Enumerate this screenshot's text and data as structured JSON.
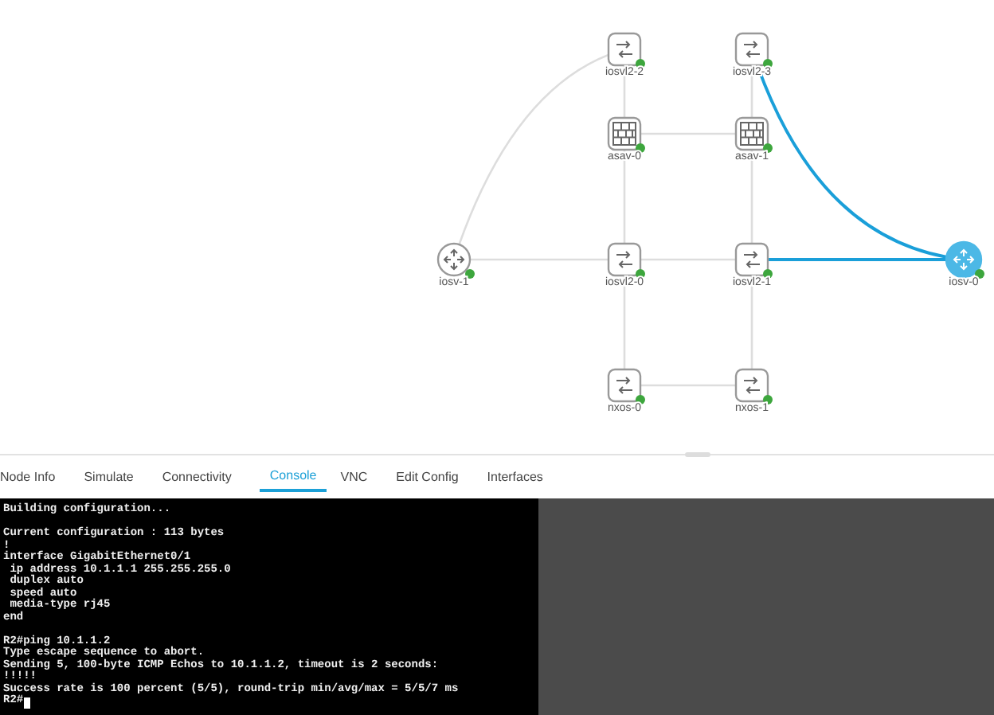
{
  "topology": {
    "nodes": [
      {
        "label": "iosvl2-2",
        "kind": "switch",
        "running": true,
        "selected": false
      },
      {
        "label": "iosvl2-3",
        "kind": "switch",
        "running": true,
        "selected": false
      },
      {
        "label": "asav-0",
        "kind": "firewall",
        "running": true,
        "selected": false
      },
      {
        "label": "asav-1",
        "kind": "firewall",
        "running": true,
        "selected": false
      },
      {
        "label": "iosv-1",
        "kind": "router",
        "running": true,
        "selected": false
      },
      {
        "label": "iosvl2-0",
        "kind": "switch",
        "running": true,
        "selected": false
      },
      {
        "label": "iosvl2-1",
        "kind": "switch",
        "running": true,
        "selected": false
      },
      {
        "label": "iosv-0",
        "kind": "router",
        "running": true,
        "selected": true
      },
      {
        "label": "nxos-0",
        "kind": "switch",
        "running": true,
        "selected": false
      },
      {
        "label": "nxos-1",
        "kind": "switch",
        "running": true,
        "selected": false
      }
    ]
  },
  "tabs": [
    {
      "label": "Node Info",
      "selected": false
    },
    {
      "label": "Simulate",
      "selected": false
    },
    {
      "label": "Connectivity",
      "selected": false
    },
    {
      "label": "Console",
      "selected": true
    },
    {
      "label": "VNC",
      "selected": false
    },
    {
      "label": "Edit Config",
      "selected": false
    },
    {
      "label": "Interfaces",
      "selected": false
    }
  ],
  "console": {
    "cursor": true,
    "blocks": [
      [
        "Building configuration..."
      ],
      [
        "Current configuration : 113 bytes",
        "!",
        "interface GigabitEthernet0/1",
        " ip address 10.1.1.1 255.255.255.0",
        " duplex auto",
        " speed auto",
        " media-type rj45",
        "end"
      ],
      [
        "R2#ping 10.1.1.2",
        "Type escape sequence to abort.",
        "Sending 5, 100-byte ICMP Echos to 10.1.1.2, timeout is 2 seconds:",
        "!!!!!",
        "Success rate is 100 percent (5/5), round-trip min/avg/max = 5/5/7 ms",
        "R2#"
      ]
    ]
  }
}
